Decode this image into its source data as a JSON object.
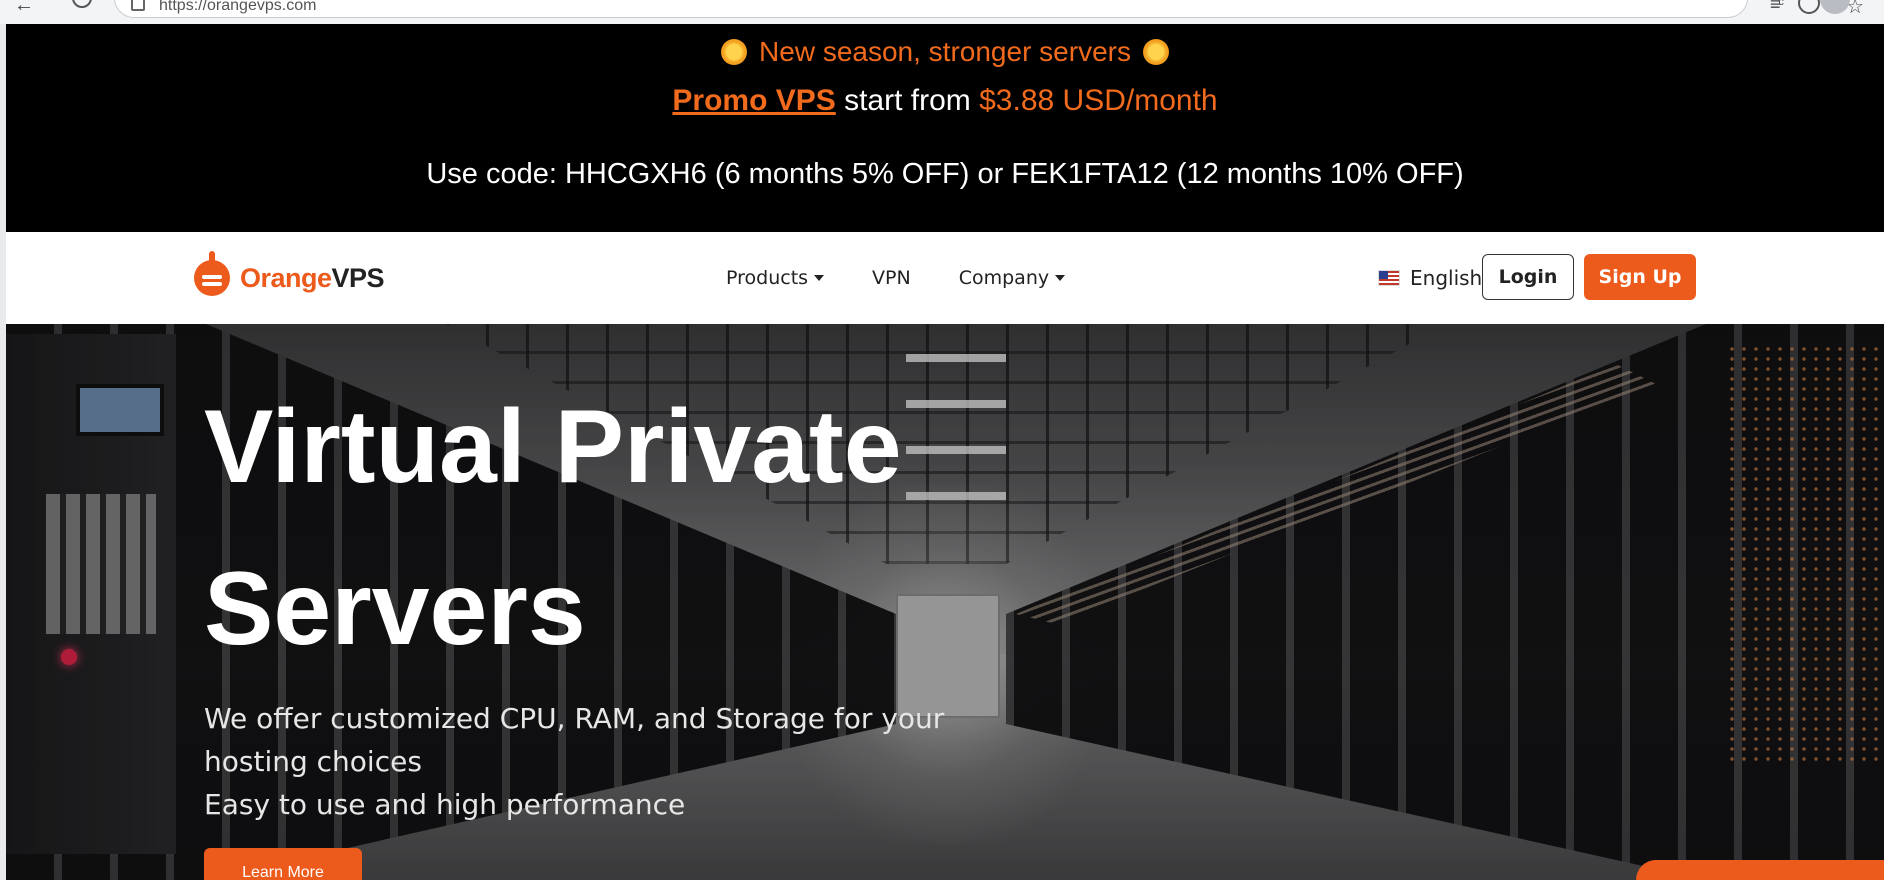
{
  "browser": {
    "url": "https://orangevps.com"
  },
  "promo": {
    "headline": "New season, stronger servers",
    "promo_link": "Promo VPS",
    "start_from": " start from ",
    "price": "$3.88 USD/month",
    "codes": "Use code: HHCGXH6 (6 months 5% OFF) or FEK1FTA12 (12 months 10% OFF)",
    "accent_color": "#f26b1d"
  },
  "navbar": {
    "logo_orange": "Orange",
    "logo_vps": "VPS",
    "items": [
      {
        "label": "Products",
        "dropdown": true
      },
      {
        "label": "VPN",
        "dropdown": false
      },
      {
        "label": "Company",
        "dropdown": true
      }
    ],
    "language": "English",
    "login_label": "Login",
    "signup_label": "Sign Up",
    "brand_color": "#ec5a1c"
  },
  "hero": {
    "title_line1": "Virtual Private",
    "title_line2": "Servers",
    "subtitle_line1": "We offer customized CPU, RAM, and Storage for your hosting choices",
    "subtitle_line2": "Easy to use and high performance",
    "cta_label": "Learn More"
  }
}
